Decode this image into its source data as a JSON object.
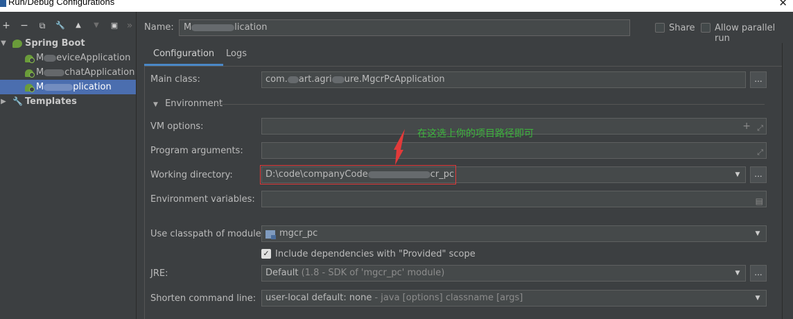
{
  "window": {
    "title": "Run/Debug Configurations"
  },
  "toolbar": {
    "add": "+",
    "remove": "−",
    "copy": "⧉",
    "edit": "🔧",
    "up": "▲",
    "down": "▼",
    "folder": "▣",
    "more": "»"
  },
  "tree": {
    "spring_boot": "Spring Boot",
    "apps": [
      "M  eviceApplication",
      "M  chatApplication",
      "M  plication"
    ],
    "templates": "Templates"
  },
  "name": {
    "label": "Name:",
    "value": "M  lication"
  },
  "share": {
    "label": "Share"
  },
  "allow_parallel": {
    "label": "Allow parallel run"
  },
  "tabs": [
    "Configuration",
    "Logs"
  ],
  "main_class": {
    "label": "Main class:",
    "value": "com.  art.agri  ure.MgcrPcApplication",
    "button": "..."
  },
  "environment": {
    "label": "Environment"
  },
  "vm_options": {
    "label": "VM options:",
    "value": ""
  },
  "program_arguments": {
    "label": "Program arguments:",
    "value": ""
  },
  "working_directory": {
    "label": "Working directory:",
    "value": "D:\\code\\companyCode  cr_pc",
    "button": "..."
  },
  "environment_variables": {
    "label": "Environment variables:",
    "value": ""
  },
  "classpath_module": {
    "label": "Use classpath of module:",
    "value": "mgcr_pc"
  },
  "include_dependencies": {
    "label": "Include dependencies with \"Provided\" scope",
    "checked": true
  },
  "jre": {
    "label": "JRE:",
    "value": "Default",
    "hint": "(1.8 - SDK of 'mgcr_pc' module)",
    "button": "..."
  },
  "shorten_command": {
    "label": "Shorten command line:",
    "value": "user-local default: none",
    "hint": "- java [options] classname [args]"
  },
  "annotation": {
    "text": "在这选上你的项目路径即可",
    "color": "#3db53d"
  },
  "colors": {
    "selection": "#4b6eaf",
    "highlight_box": "#e23a3a",
    "tab_underline": "#4a88c7"
  }
}
